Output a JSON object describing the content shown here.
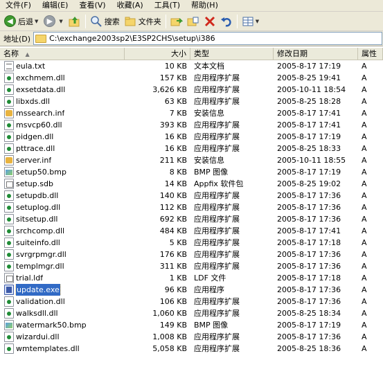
{
  "menubar": {
    "items": [
      "文件(F)",
      "编辑(E)",
      "查看(V)",
      "收藏(A)",
      "工具(T)",
      "帮助(H)"
    ]
  },
  "toolbar": {
    "back_label": "后退",
    "search_label": "搜索",
    "folders_label": "文件夹"
  },
  "address": {
    "label": "地址(D)",
    "path": "C:\\exchange2003sp2\\E3SP2CHS\\setup\\i386"
  },
  "columns": {
    "name": "名称",
    "size": "大小",
    "type": "类型",
    "modified": "修改日期",
    "attributes": "属性"
  },
  "files": [
    {
      "name": "eula.txt",
      "icon": "text-file-icon",
      "size": "10 KB",
      "type": "文本文档",
      "modified": "2005-8-17 17:19",
      "attr": "A"
    },
    {
      "name": "exchmem.dll",
      "icon": "dll-file-icon",
      "size": "157 KB",
      "type": "应用程序扩展",
      "modified": "2005-8-25 19:41",
      "attr": "A"
    },
    {
      "name": "exsetdata.dll",
      "icon": "dll-file-icon",
      "size": "3,626 KB",
      "type": "应用程序扩展",
      "modified": "2005-10-11 18:54",
      "attr": "A"
    },
    {
      "name": "libxds.dll",
      "icon": "dll-file-icon",
      "size": "63 KB",
      "type": "应用程序扩展",
      "modified": "2005-8-25 18:28",
      "attr": "A"
    },
    {
      "name": "mssearch.inf",
      "icon": "inf-file-icon",
      "size": "7 KB",
      "type": "安装信息",
      "modified": "2005-8-17 17:41",
      "attr": "A"
    },
    {
      "name": "msvcp60.dll",
      "icon": "dll-file-icon",
      "size": "393 KB",
      "type": "应用程序扩展",
      "modified": "2005-8-17 17:41",
      "attr": "A"
    },
    {
      "name": "pidgen.dll",
      "icon": "dll-file-icon",
      "size": "16 KB",
      "type": "应用程序扩展",
      "modified": "2005-8-17 17:19",
      "attr": "A"
    },
    {
      "name": "pttrace.dll",
      "icon": "dll-file-icon",
      "size": "16 KB",
      "type": "应用程序扩展",
      "modified": "2005-8-25 18:33",
      "attr": "A"
    },
    {
      "name": "server.inf",
      "icon": "inf-file-icon",
      "size": "211 KB",
      "type": "安装信息",
      "modified": "2005-10-11 18:55",
      "attr": "A"
    },
    {
      "name": "setup50.bmp",
      "icon": "bmp-file-icon",
      "size": "8 KB",
      "type": "BMP 图像",
      "modified": "2005-8-17 17:19",
      "attr": "A"
    },
    {
      "name": "setup.sdb",
      "icon": "sdb-file-icon",
      "size": "14 KB",
      "type": "Appfix 软件包",
      "modified": "2005-8-25 19:02",
      "attr": "A"
    },
    {
      "name": "setupdb.dll",
      "icon": "dll-file-icon",
      "size": "140 KB",
      "type": "应用程序扩展",
      "modified": "2005-8-17 17:36",
      "attr": "A"
    },
    {
      "name": "setuplog.dll",
      "icon": "dll-file-icon",
      "size": "112 KB",
      "type": "应用程序扩展",
      "modified": "2005-8-17 17:36",
      "attr": "A"
    },
    {
      "name": "sitsetup.dll",
      "icon": "dll-file-icon",
      "size": "692 KB",
      "type": "应用程序扩展",
      "modified": "2005-8-17 17:36",
      "attr": "A"
    },
    {
      "name": "srchcomp.dll",
      "icon": "dll-file-icon",
      "size": "484 KB",
      "type": "应用程序扩展",
      "modified": "2005-8-17 17:41",
      "attr": "A"
    },
    {
      "name": "suiteinfo.dll",
      "icon": "dll-file-icon",
      "size": "5 KB",
      "type": "应用程序扩展",
      "modified": "2005-8-17 17:18",
      "attr": "A"
    },
    {
      "name": "svrgrpmgr.dll",
      "icon": "dll-file-icon",
      "size": "176 KB",
      "type": "应用程序扩展",
      "modified": "2005-8-17 17:36",
      "attr": "A"
    },
    {
      "name": "templmgr.dll",
      "icon": "dll-file-icon",
      "size": "311 KB",
      "type": "应用程序扩展",
      "modified": "2005-8-17 17:36",
      "attr": "A"
    },
    {
      "name": "trial.ldf",
      "icon": "ldf-file-icon",
      "size": "1 KB",
      "type": "LDF 文件",
      "modified": "2005-8-17 17:18",
      "attr": "A"
    },
    {
      "name": "update.exe",
      "icon": "exe-file-icon",
      "size": "96 KB",
      "type": "应用程序",
      "modified": "2005-8-17 17:36",
      "attr": "A",
      "selected": true
    },
    {
      "name": "validation.dll",
      "icon": "dll-file-icon",
      "size": "106 KB",
      "type": "应用程序扩展",
      "modified": "2005-8-17 17:36",
      "attr": "A"
    },
    {
      "name": "walksdll.dll",
      "icon": "dll-file-icon",
      "size": "1,060 KB",
      "type": "应用程序扩展",
      "modified": "2005-8-25 18:34",
      "attr": "A"
    },
    {
      "name": "watermark50.bmp",
      "icon": "bmp-file-icon",
      "size": "149 KB",
      "type": "BMP 图像",
      "modified": "2005-8-17 17:19",
      "attr": "A"
    },
    {
      "name": "wizardui.dll",
      "icon": "dll-file-icon",
      "size": "1,008 KB",
      "type": "应用程序扩展",
      "modified": "2005-8-17 17:36",
      "attr": "A"
    },
    {
      "name": "wmtemplates.dll",
      "icon": "dll-file-icon",
      "size": "5,058 KB",
      "type": "应用程序扩展",
      "modified": "2005-8-25 18:36",
      "attr": "A"
    }
  ]
}
